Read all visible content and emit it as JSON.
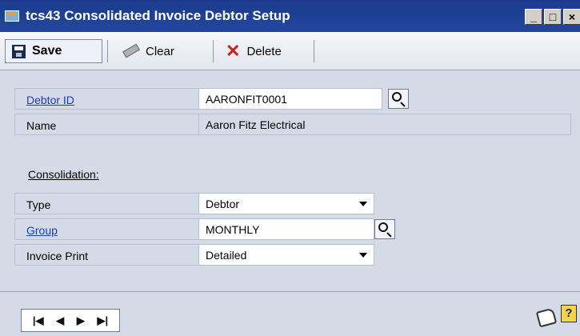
{
  "window": {
    "title": "tcs43 Consolidated Invoice Debtor Setup",
    "icons": [
      "app-window-icon",
      "minimize-icon",
      "maximize-icon",
      "close-icon"
    ]
  },
  "toolbar": {
    "save_label": "Save",
    "clear_label": "Clear",
    "delete_label": "Delete"
  },
  "form": {
    "debtor_id": {
      "label": "Debtor ID",
      "value": "AARONFIT0001"
    },
    "name": {
      "label": "Name",
      "value": "Aaron Fitz Electrical"
    },
    "section_label": "Consolidation:",
    "type": {
      "label": "Type",
      "value": "Debtor"
    },
    "group": {
      "label": "Group",
      "value": "MONTHLY"
    },
    "invoice_print": {
      "label": "Invoice Print",
      "value": "Detailed"
    }
  },
  "navigation": {
    "first": "|◀",
    "prev": "◀",
    "next": "▶",
    "last": "▶|"
  },
  "colors": {
    "titlebar": "#1b3c8e",
    "background": "#d4dbe6",
    "link": "#1a3cc8",
    "delete_x": "#c8201e"
  }
}
